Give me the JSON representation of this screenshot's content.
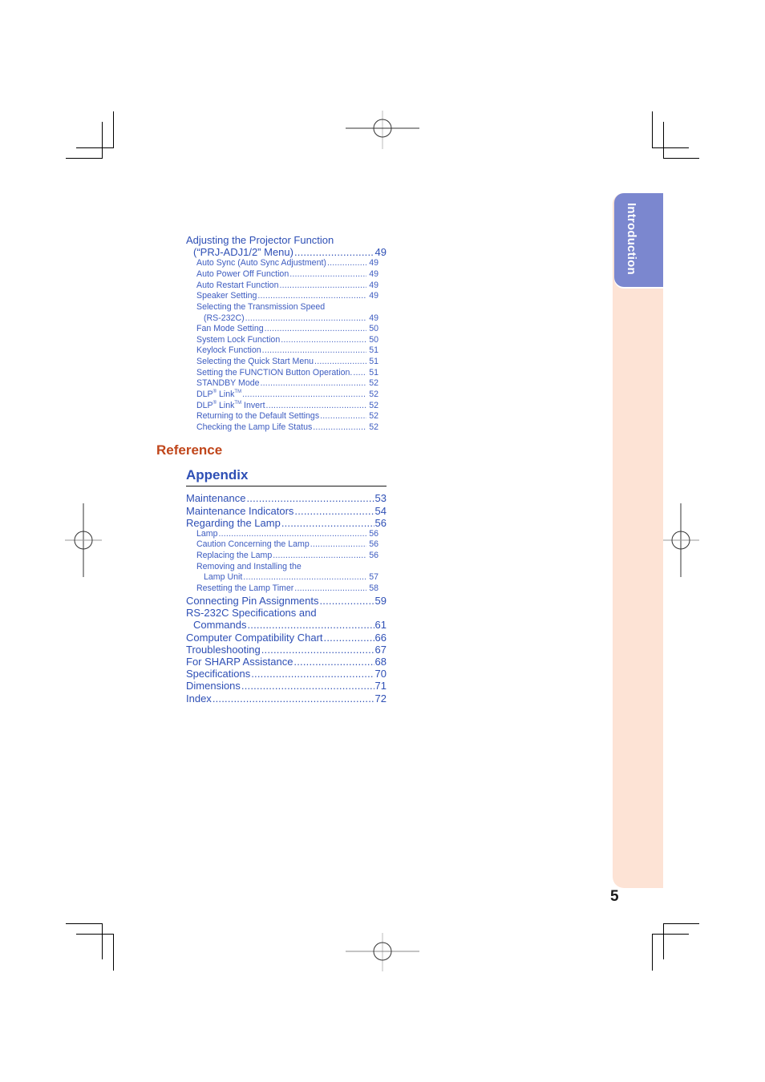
{
  "side_tab": {
    "label": "Introduction",
    "color": "#7b87cf",
    "panel_color": "#fde3d5"
  },
  "page_number": "5",
  "toc_top": [
    {
      "label": "Adjusting the Projector Function",
      "page": "",
      "level": 1
    },
    {
      "label": "(“PRJ-ADJ1/2” Menu)",
      "page": "49",
      "level": 1,
      "continuation": true
    },
    {
      "label": "Auto Sync (Auto Sync Adjustment)",
      "page": "49",
      "level": 2
    },
    {
      "label": "Auto Power Off Function",
      "page": "49",
      "level": 2
    },
    {
      "label": "Auto Restart Function",
      "page": "49",
      "level": 2
    },
    {
      "label": "Speaker Setting",
      "page": "49",
      "level": 2
    },
    {
      "label": "Selecting the Transmission Speed",
      "page": "",
      "level": 2
    },
    {
      "label": "(RS-232C)",
      "page": "49",
      "level": 2,
      "continuation": true
    },
    {
      "label": "Fan Mode Setting",
      "page": "50",
      "level": 2
    },
    {
      "label": "System Lock Function",
      "page": "50",
      "level": 2
    },
    {
      "label": "Keylock Function",
      "page": "51",
      "level": 2
    },
    {
      "label": "Selecting the Quick Start Menu",
      "page": "51",
      "level": 2
    },
    {
      "label": "Setting the FUNCTION Button Operation.",
      "page": "51",
      "level": 2
    },
    {
      "label": "STANDBY Mode",
      "page": "52",
      "level": 2
    },
    {
      "label": "DLP® Link™",
      "page": "52",
      "level": 2,
      "parts": [
        "DLP",
        "®",
        " Link",
        "TM",
        ""
      ]
    },
    {
      "label": "DLP® Link™ Invert",
      "page": "52",
      "level": 2,
      "parts": [
        "DLP",
        "®",
        " Link",
        "TM",
        " Invert"
      ]
    },
    {
      "label": "Returning to the Default Settings",
      "page": "52",
      "level": 2
    },
    {
      "label": "Checking the Lamp Life Status",
      "page": "52",
      "level": 2
    }
  ],
  "section": {
    "title": "Reference"
  },
  "subsection": {
    "title": "Appendix"
  },
  "toc_appendix": [
    {
      "label": "Maintenance",
      "page": "53",
      "level": 1
    },
    {
      "label": "Maintenance Indicators",
      "page": "54",
      "level": 1
    },
    {
      "label": "Regarding the Lamp",
      "page": "56",
      "level": 1
    },
    {
      "label": "Lamp",
      "page": "56",
      "level": 2
    },
    {
      "label": "Caution Concerning the Lamp",
      "page": "56",
      "level": 2
    },
    {
      "label": "Replacing the Lamp",
      "page": "56",
      "level": 2
    },
    {
      "label": "Removing and Installing the",
      "page": "",
      "level": 2
    },
    {
      "label": "Lamp Unit",
      "page": "57",
      "level": 2,
      "continuation": true
    },
    {
      "label": "Resetting the Lamp Timer",
      "page": "58",
      "level": 2
    },
    {
      "label": "Connecting Pin Assignments",
      "page": "59",
      "level": 1
    },
    {
      "label": "RS-232C Specifications and",
      "page": "",
      "level": 1
    },
    {
      "label": "Commands",
      "page": "61",
      "level": 1,
      "continuation": true
    },
    {
      "label": "Computer Compatibility Chart",
      "page": "66",
      "level": 1
    },
    {
      "label": "Troubleshooting",
      "page": "67",
      "level": 1
    },
    {
      "label": "For SHARP Assistance",
      "page": "68",
      "level": 1
    },
    {
      "label": "Specifications",
      "page": "70",
      "level": 1
    },
    {
      "label": "Dimensions",
      "page": "71",
      "level": 1
    },
    {
      "label": "Index",
      "page": "72",
      "level": 1
    }
  ]
}
